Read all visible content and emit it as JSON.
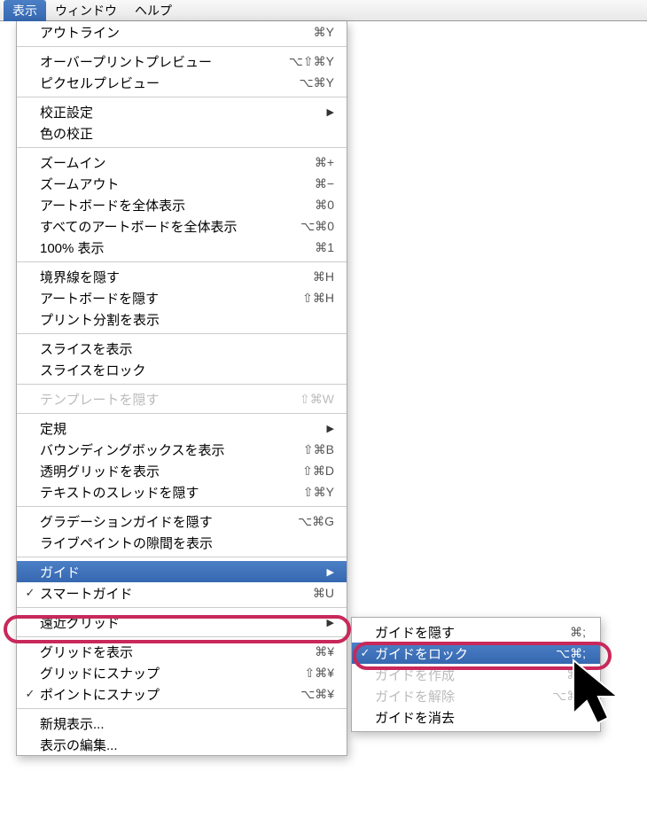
{
  "menubar": {
    "view": "表示",
    "window": "ウィンドウ",
    "help": "ヘルプ"
  },
  "menu": {
    "outline": {
      "label": "アウトライン",
      "shortcut": "⌘Y"
    },
    "overprint_preview": {
      "label": "オーバープリントプレビュー",
      "shortcut": "⌥⇧⌘Y"
    },
    "pixel_preview": {
      "label": "ピクセルプレビュー",
      "shortcut": "⌥⌘Y"
    },
    "proof_setup": {
      "label": "校正設定"
    },
    "proof_colors": {
      "label": "色の校正"
    },
    "zoom_in": {
      "label": "ズームイン",
      "shortcut": "⌘+"
    },
    "zoom_out": {
      "label": "ズームアウト",
      "shortcut": "⌘−"
    },
    "fit_artboard": {
      "label": "アートボードを全体表示",
      "shortcut": "⌘0"
    },
    "fit_all": {
      "label": "すべてのアートボードを全体表示",
      "shortcut": "⌥⌘0"
    },
    "actual_size": {
      "label": "100% 表示",
      "shortcut": "⌘1"
    },
    "hide_edges": {
      "label": "境界線を隠す",
      "shortcut": "⌘H"
    },
    "hide_artboards": {
      "label": "アートボードを隠す",
      "shortcut": "⇧⌘H"
    },
    "show_print_tiling": {
      "label": "プリント分割を表示"
    },
    "show_slices": {
      "label": "スライスを表示"
    },
    "lock_slices": {
      "label": "スライスをロック"
    },
    "hide_template": {
      "label": "テンプレートを隠す",
      "shortcut": "⇧⌘W"
    },
    "rulers": {
      "label": "定規"
    },
    "show_bbox": {
      "label": "バウンディングボックスを表示",
      "shortcut": "⇧⌘B"
    },
    "show_tgrid": {
      "label": "透明グリッドを表示",
      "shortcut": "⇧⌘D"
    },
    "hide_text_threads": {
      "label": "テキストのスレッドを隠す",
      "shortcut": "⇧⌘Y"
    },
    "hide_gradient": {
      "label": "グラデーションガイドを隠す",
      "shortcut": "⌥⌘G"
    },
    "show_livepaint": {
      "label": "ライブペイントの隙間を表示"
    },
    "guides": {
      "label": "ガイド"
    },
    "smart_guides": {
      "label": "スマートガイド",
      "shortcut": "⌘U"
    },
    "perspective": {
      "label": "遠近グリッド"
    },
    "show_grid": {
      "label": "グリッドを表示",
      "shortcut": "⌘¥"
    },
    "snap_grid": {
      "label": "グリッドにスナップ",
      "shortcut": "⇧⌘¥"
    },
    "snap_point": {
      "label": "ポイントにスナップ",
      "shortcut": "⌥⌘¥"
    },
    "new_view": {
      "label": "新規表示..."
    },
    "edit_views": {
      "label": "表示の編集..."
    }
  },
  "submenu": {
    "hide_guides": {
      "label": "ガイドを隠す",
      "shortcut": "⌘;"
    },
    "lock_guides": {
      "label": "ガイドをロック",
      "shortcut": "⌥⌘;"
    },
    "make_guides": {
      "label": "ガイドを作成",
      "shortcut": "⌘5"
    },
    "release_guides": {
      "label": "ガイドを解除",
      "shortcut": "⌥⌘5"
    },
    "clear_guides": {
      "label": "ガイドを消去"
    }
  }
}
